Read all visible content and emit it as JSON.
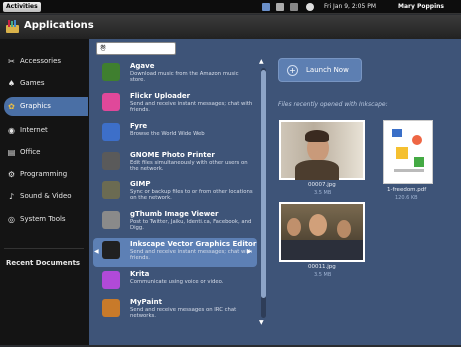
{
  "topbar": {
    "activities": "Activities",
    "clock": "Fri Jan 9, 2:05 PM",
    "user": "Mary Poppins"
  },
  "header": {
    "title": "Applications"
  },
  "sidebar": {
    "categories": [
      {
        "label": "Accessories",
        "icon": "accessories-icon"
      },
      {
        "label": "Games",
        "icon": "games-icon"
      },
      {
        "label": "Graphics",
        "icon": "graphics-icon",
        "active": true
      },
      {
        "label": "Internet",
        "icon": "internet-icon"
      },
      {
        "label": "Office",
        "icon": "office-icon"
      },
      {
        "label": "Programming",
        "icon": "programming-icon"
      },
      {
        "label": "Sound & Video",
        "icon": "sound-video-icon"
      },
      {
        "label": "System Tools",
        "icon": "system-tools-icon"
      }
    ],
    "recent_documents": "Recent Documents"
  },
  "search": {
    "value": "巻"
  },
  "apps": [
    {
      "name": "Agave",
      "desc": "Download music from the Amazon music store.",
      "color": "#3f7f2f"
    },
    {
      "name": "Flickr Uploader",
      "desc": "Send and receive instant messages; chat with friends.",
      "color": "#e0489a"
    },
    {
      "name": "Fyre",
      "desc": "Browse the World Wide Web",
      "color": "#3d6fc9"
    },
    {
      "name": "GNOME Photo Printer",
      "desc": "Edit files simultaneously with other users on the network.",
      "color": "#5a5a5a"
    },
    {
      "name": "GIMP",
      "desc": "Sync or backup files to or from other locations on the network.",
      "color": "#6b6b52"
    },
    {
      "name": "gThumb Image Viewer",
      "desc": "Post to Twitter, Jaiku, Identi.ca, Facebook, and Digg.",
      "color": "#8a8a8a"
    },
    {
      "name": "Inkscape Vector Graphics Editor",
      "desc": "Send and receive instant messages; chat with friends.",
      "color": "#202020",
      "selected": true
    },
    {
      "name": "Krita",
      "desc": "Communicate using voice or video.",
      "color": "#b04ad8"
    },
    {
      "name": "MyPaint",
      "desc": "Send and receive messages on IRC chat networks.",
      "color": "#c87a2a"
    }
  ],
  "launch": {
    "label": "Launch Now"
  },
  "recent_files": {
    "title": "Files recently opened with Inkscape:",
    "files": [
      {
        "name": "00007.jpg",
        "size": "3.5 MB",
        "kind": "photo-man-icon"
      },
      {
        "name": "1-freedom.pdf",
        "size": "120.6 KB",
        "kind": "pdf-document-icon"
      },
      {
        "name": "00011.jpg",
        "size": "3.5 MB",
        "kind": "photo-group-icon"
      }
    ]
  }
}
